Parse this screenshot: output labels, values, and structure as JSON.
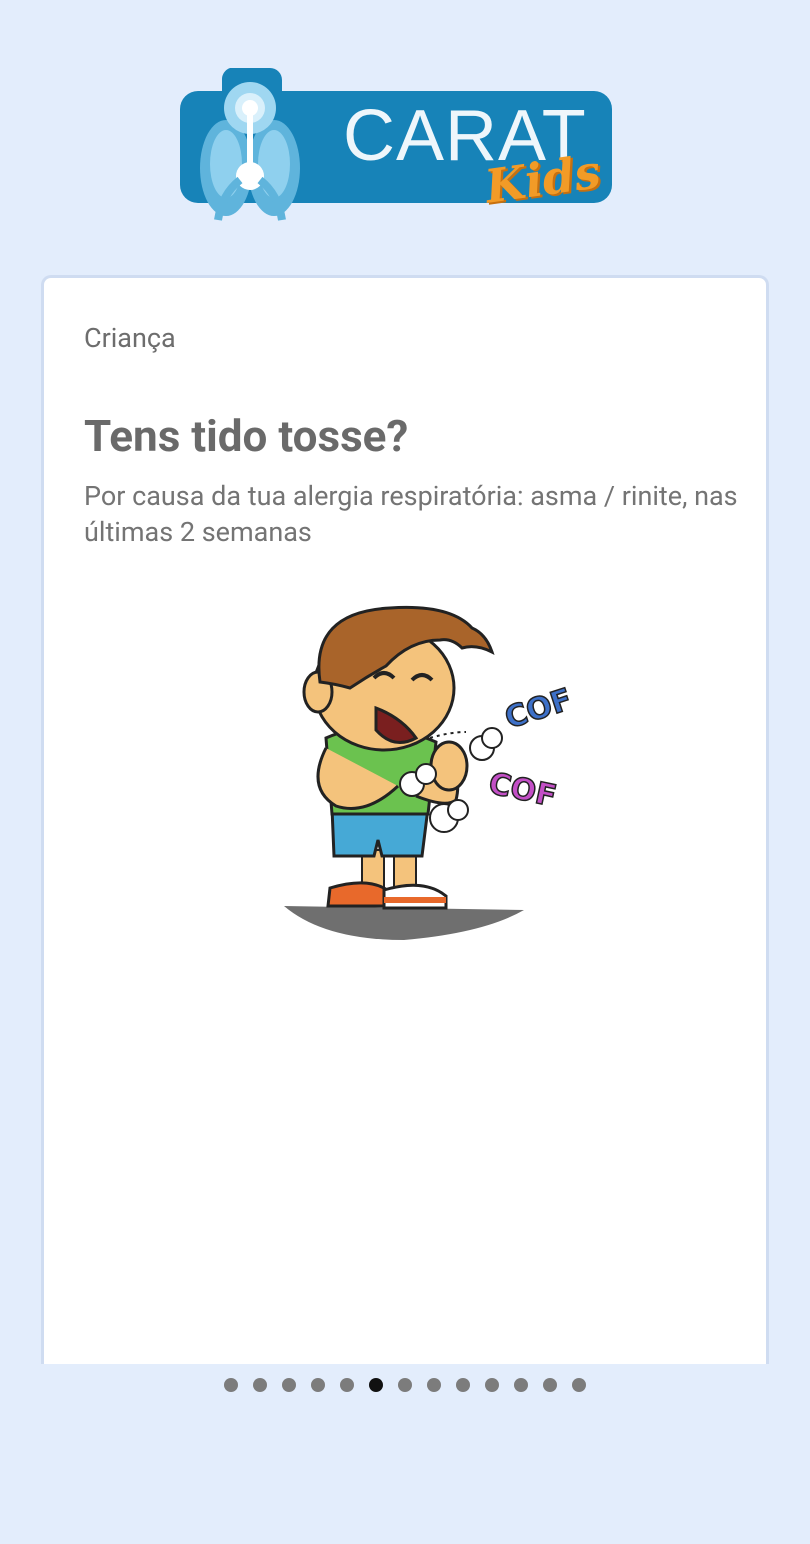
{
  "logo": {
    "word": "CARAT",
    "sub": "Kids"
  },
  "card": {
    "profile": "Criança",
    "question": "Tens tido tosse?",
    "subtitle": "Por causa da tua alergia respiratória: asma / rinite, nas últimas 2 semanas",
    "illustration": {
      "icon": "coughing-boy-illustration",
      "cough_text_1": "COF",
      "cough_text_2": "COF"
    }
  },
  "pager": {
    "total": 13,
    "active_index": 5
  },
  "colors": {
    "background": "#e3edfc",
    "brand_blue": "#1783b8",
    "brand_orange": "#f29b27",
    "active_dot": "#111111",
    "inactive_dot": "#7c7c7c"
  }
}
